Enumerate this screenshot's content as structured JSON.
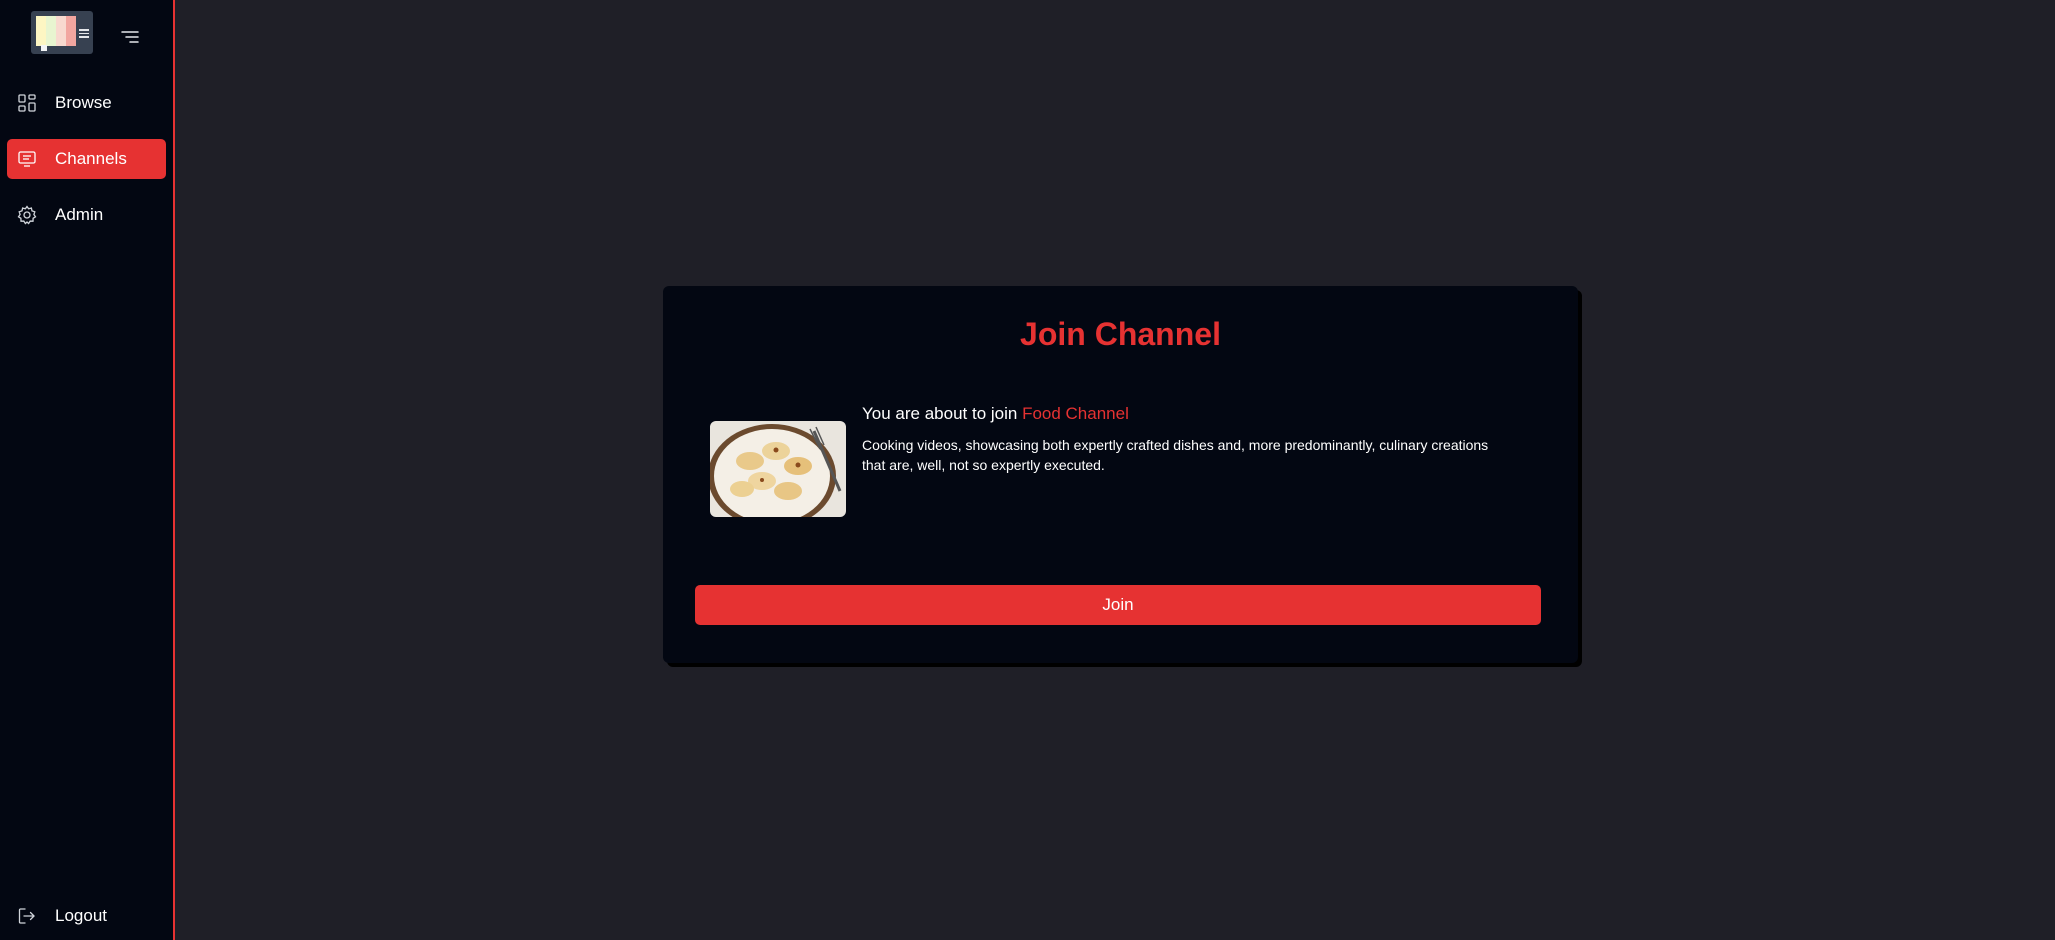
{
  "sidebar": {
    "logo_colors": [
      "#fdf6c3",
      "#e8f5d0",
      "#f8d9cf",
      "#f2a6a0"
    ],
    "items": [
      {
        "label": "Browse",
        "icon": "dashboard-icon"
      },
      {
        "label": "Channels",
        "icon": "monitor-icon",
        "active": true
      },
      {
        "label": "Admin",
        "icon": "gear-icon"
      }
    ],
    "logout": {
      "label": "Logout",
      "icon": "logout-icon"
    }
  },
  "card": {
    "title": "Join Channel",
    "intro_prefix": "You are about to join ",
    "channel_name": "Food Channel",
    "description": "Cooking videos, showcasing both expertly crafted dishes and, more predominantly, culinary creations that are, well, not so expertly executed.",
    "button_label": "Join"
  },
  "colors": {
    "accent": "#e63232",
    "sidebar_bg": "#030712",
    "main_bg": "#1f1f27",
    "card_bg": "#030712"
  }
}
